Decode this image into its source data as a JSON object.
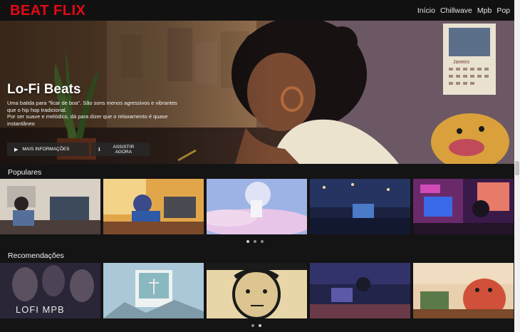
{
  "app": {
    "logo": "BEAT FLIX",
    "brand_color": "#e50914"
  },
  "nav": {
    "items": [
      "Início",
      "Chillwave",
      "Mpb",
      "Pop"
    ]
  },
  "hero": {
    "title": "Lo-Fi Beats",
    "description": "Uma batida para \"ficar de boa\". São sons menos agressivos e vibrantes que o hip hop tradicional.\nPor ser suave e melódico, dá para dizer que o relaxamento é quase instantâneo",
    "btn_more": "MAIS INFORMAÇÕES",
    "btn_watch": "ASSISTIR AGORA",
    "btn_more_icon": "play-icon",
    "btn_watch_icon": "info-icon",
    "calendar_month": "Janeiro"
  },
  "sections": {
    "popular": {
      "title": "Populares",
      "page_count": 3,
      "active_page": 1
    },
    "recommended": {
      "title": "Recomendações",
      "page_count": 2,
      "active_page": 2,
      "first_card_text": "LOFI MPB"
    }
  }
}
